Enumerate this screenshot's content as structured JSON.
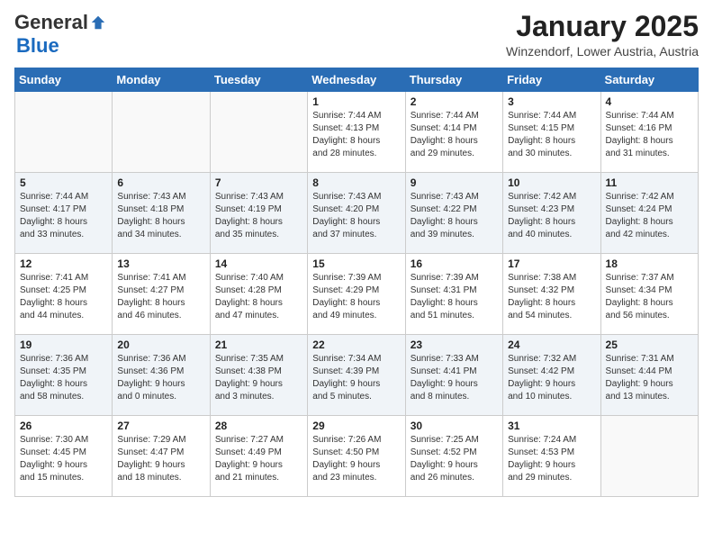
{
  "logo": {
    "general": "General",
    "blue": "Blue"
  },
  "header": {
    "month": "January 2025",
    "location": "Winzendorf, Lower Austria, Austria"
  },
  "days_of_week": [
    "Sunday",
    "Monday",
    "Tuesday",
    "Wednesday",
    "Thursday",
    "Friday",
    "Saturday"
  ],
  "weeks": [
    [
      {
        "day": "",
        "info": ""
      },
      {
        "day": "",
        "info": ""
      },
      {
        "day": "",
        "info": ""
      },
      {
        "day": "1",
        "info": "Sunrise: 7:44 AM\nSunset: 4:13 PM\nDaylight: 8 hours\nand 28 minutes."
      },
      {
        "day": "2",
        "info": "Sunrise: 7:44 AM\nSunset: 4:14 PM\nDaylight: 8 hours\nand 29 minutes."
      },
      {
        "day": "3",
        "info": "Sunrise: 7:44 AM\nSunset: 4:15 PM\nDaylight: 8 hours\nand 30 minutes."
      },
      {
        "day": "4",
        "info": "Sunrise: 7:44 AM\nSunset: 4:16 PM\nDaylight: 8 hours\nand 31 minutes."
      }
    ],
    [
      {
        "day": "5",
        "info": "Sunrise: 7:44 AM\nSunset: 4:17 PM\nDaylight: 8 hours\nand 33 minutes."
      },
      {
        "day": "6",
        "info": "Sunrise: 7:43 AM\nSunset: 4:18 PM\nDaylight: 8 hours\nand 34 minutes."
      },
      {
        "day": "7",
        "info": "Sunrise: 7:43 AM\nSunset: 4:19 PM\nDaylight: 8 hours\nand 35 minutes."
      },
      {
        "day": "8",
        "info": "Sunrise: 7:43 AM\nSunset: 4:20 PM\nDaylight: 8 hours\nand 37 minutes."
      },
      {
        "day": "9",
        "info": "Sunrise: 7:43 AM\nSunset: 4:22 PM\nDaylight: 8 hours\nand 39 minutes."
      },
      {
        "day": "10",
        "info": "Sunrise: 7:42 AM\nSunset: 4:23 PM\nDaylight: 8 hours\nand 40 minutes."
      },
      {
        "day": "11",
        "info": "Sunrise: 7:42 AM\nSunset: 4:24 PM\nDaylight: 8 hours\nand 42 minutes."
      }
    ],
    [
      {
        "day": "12",
        "info": "Sunrise: 7:41 AM\nSunset: 4:25 PM\nDaylight: 8 hours\nand 44 minutes."
      },
      {
        "day": "13",
        "info": "Sunrise: 7:41 AM\nSunset: 4:27 PM\nDaylight: 8 hours\nand 46 minutes."
      },
      {
        "day": "14",
        "info": "Sunrise: 7:40 AM\nSunset: 4:28 PM\nDaylight: 8 hours\nand 47 minutes."
      },
      {
        "day": "15",
        "info": "Sunrise: 7:39 AM\nSunset: 4:29 PM\nDaylight: 8 hours\nand 49 minutes."
      },
      {
        "day": "16",
        "info": "Sunrise: 7:39 AM\nSunset: 4:31 PM\nDaylight: 8 hours\nand 51 minutes."
      },
      {
        "day": "17",
        "info": "Sunrise: 7:38 AM\nSunset: 4:32 PM\nDaylight: 8 hours\nand 54 minutes."
      },
      {
        "day": "18",
        "info": "Sunrise: 7:37 AM\nSunset: 4:34 PM\nDaylight: 8 hours\nand 56 minutes."
      }
    ],
    [
      {
        "day": "19",
        "info": "Sunrise: 7:36 AM\nSunset: 4:35 PM\nDaylight: 8 hours\nand 58 minutes."
      },
      {
        "day": "20",
        "info": "Sunrise: 7:36 AM\nSunset: 4:36 PM\nDaylight: 9 hours\nand 0 minutes."
      },
      {
        "day": "21",
        "info": "Sunrise: 7:35 AM\nSunset: 4:38 PM\nDaylight: 9 hours\nand 3 minutes."
      },
      {
        "day": "22",
        "info": "Sunrise: 7:34 AM\nSunset: 4:39 PM\nDaylight: 9 hours\nand 5 minutes."
      },
      {
        "day": "23",
        "info": "Sunrise: 7:33 AM\nSunset: 4:41 PM\nDaylight: 9 hours\nand 8 minutes."
      },
      {
        "day": "24",
        "info": "Sunrise: 7:32 AM\nSunset: 4:42 PM\nDaylight: 9 hours\nand 10 minutes."
      },
      {
        "day": "25",
        "info": "Sunrise: 7:31 AM\nSunset: 4:44 PM\nDaylight: 9 hours\nand 13 minutes."
      }
    ],
    [
      {
        "day": "26",
        "info": "Sunrise: 7:30 AM\nSunset: 4:45 PM\nDaylight: 9 hours\nand 15 minutes."
      },
      {
        "day": "27",
        "info": "Sunrise: 7:29 AM\nSunset: 4:47 PM\nDaylight: 9 hours\nand 18 minutes."
      },
      {
        "day": "28",
        "info": "Sunrise: 7:27 AM\nSunset: 4:49 PM\nDaylight: 9 hours\nand 21 minutes."
      },
      {
        "day": "29",
        "info": "Sunrise: 7:26 AM\nSunset: 4:50 PM\nDaylight: 9 hours\nand 23 minutes."
      },
      {
        "day": "30",
        "info": "Sunrise: 7:25 AM\nSunset: 4:52 PM\nDaylight: 9 hours\nand 26 minutes."
      },
      {
        "day": "31",
        "info": "Sunrise: 7:24 AM\nSunset: 4:53 PM\nDaylight: 9 hours\nand 29 minutes."
      },
      {
        "day": "",
        "info": ""
      }
    ]
  ]
}
